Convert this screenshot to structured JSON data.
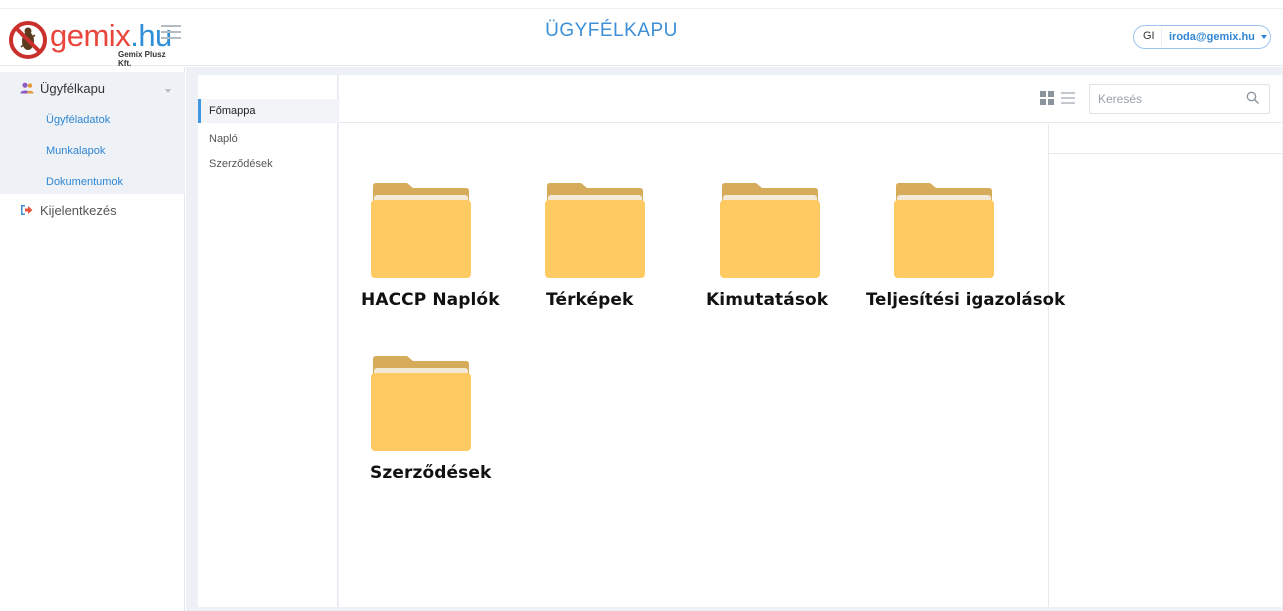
{
  "header": {
    "logo_text_main": "gemix",
    "logo_text_domain": ".hu",
    "logo_subtitle": "Gemix Plusz Kft.",
    "title": "ÜGYFÉLKAPU",
    "user_initials": "GI",
    "user_email": "iroda@gemix.hu"
  },
  "sidebar": {
    "section_label": "Ügyfélkapu",
    "items": [
      {
        "label": "Ügyféladatok"
      },
      {
        "label": "Munkalapok"
      },
      {
        "label": "Dokumentumok"
      }
    ],
    "logout_label": "Kijelentkezés"
  },
  "tree": {
    "items": [
      {
        "label": "Főmappa",
        "active": true
      },
      {
        "label": "Napló",
        "active": false
      },
      {
        "label": "Szerződések",
        "active": false
      }
    ]
  },
  "toolbar": {
    "search_placeholder": "Keresés"
  },
  "folders": [
    {
      "label": "HACCP Naplók"
    },
    {
      "label": "Térképek"
    },
    {
      "label": "Kimutatások"
    },
    {
      "label": "Teljesítési igazolások"
    },
    {
      "label": "Szerződések"
    }
  ],
  "colors": {
    "accent": "#2f86d4",
    "folder_front": "#ffca62",
    "folder_back": "#d6ac5a"
  }
}
